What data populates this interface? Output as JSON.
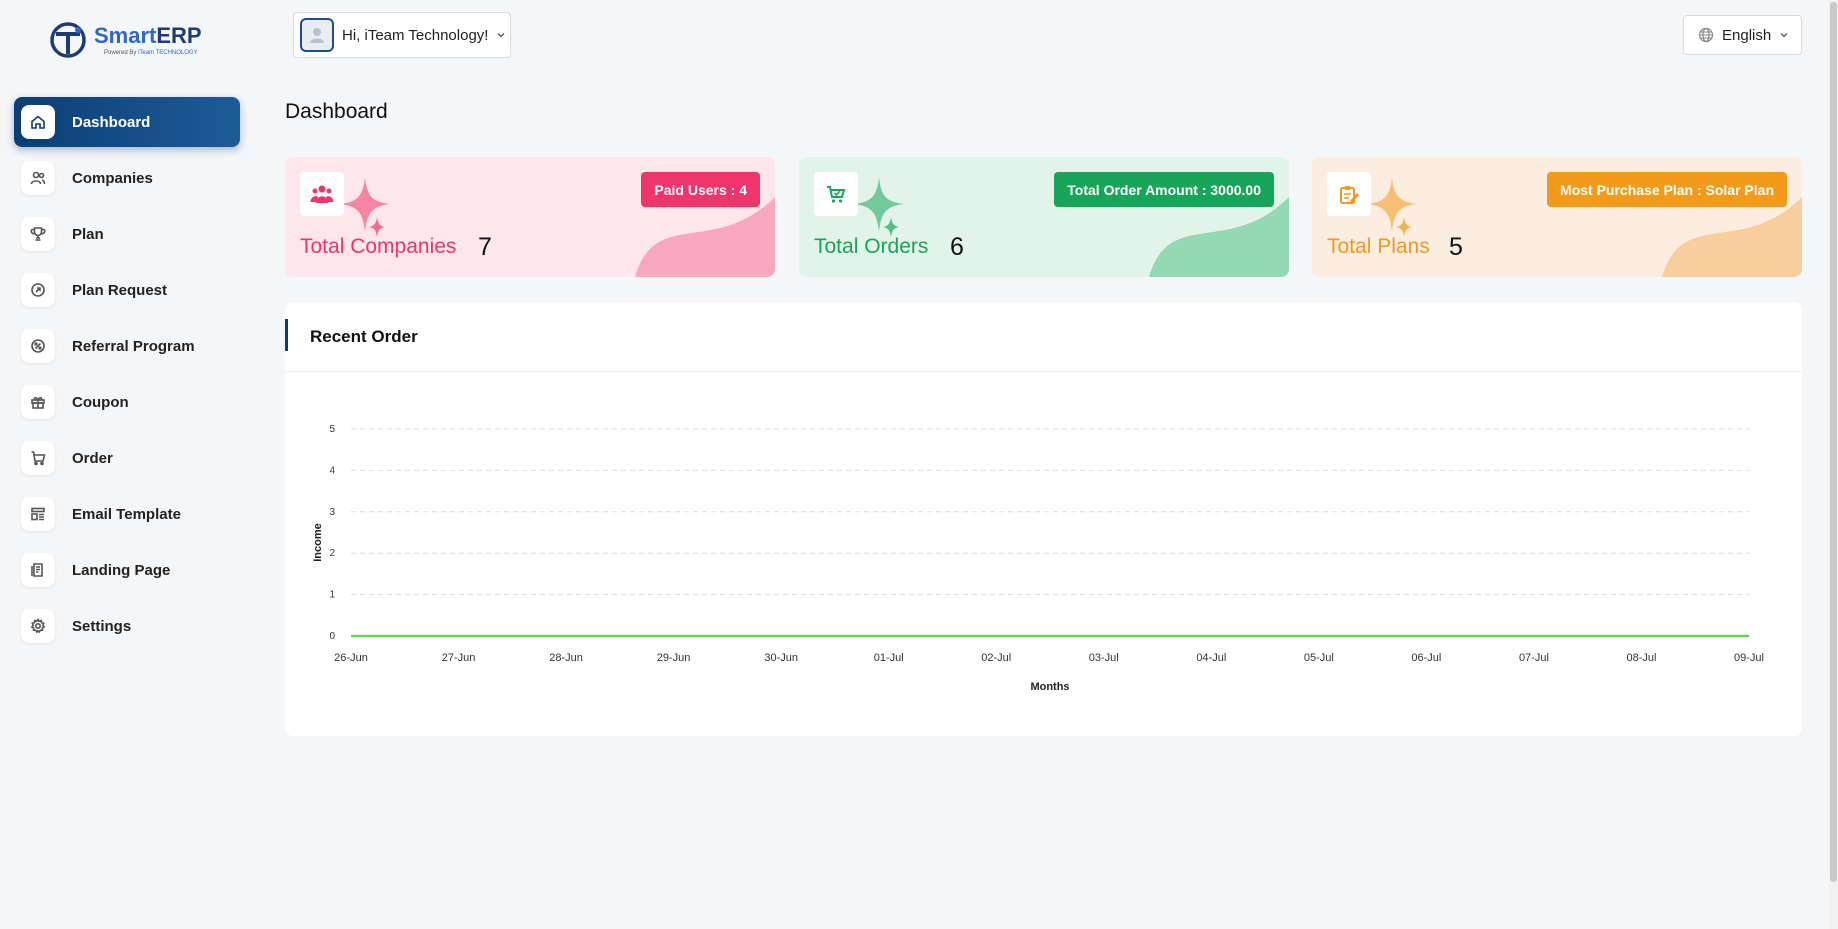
{
  "app": {
    "brand_name_part1": "Smart",
    "brand_name_part2": "ERP",
    "powered_by": "Powered By",
    "powered_brand": "iTeam TECHNOLOGY"
  },
  "sidebar": {
    "items": [
      {
        "label": "Dashboard",
        "icon": "home-icon",
        "active": true
      },
      {
        "label": "Companies",
        "icon": "users-icon"
      },
      {
        "label": "Plan",
        "icon": "trophy-icon"
      },
      {
        "label": "Plan Request",
        "icon": "arrow-circle-icon"
      },
      {
        "label": "Referral Program",
        "icon": "discount-icon"
      },
      {
        "label": "Coupon",
        "icon": "gift-icon"
      },
      {
        "label": "Order",
        "icon": "cart-icon"
      },
      {
        "label": " Email Template",
        "icon": "template-icon"
      },
      {
        "label": "Landing Page",
        "icon": "page-icon"
      },
      {
        "label": "Settings",
        "icon": "gear-icon"
      }
    ]
  },
  "header": {
    "user_greeting": "Hi, iTeam Technology!",
    "language": "English"
  },
  "page": {
    "title": "Dashboard"
  },
  "cards": [
    {
      "label": "Total Companies",
      "value": "7",
      "badge": "Paid Users : 4",
      "color": "#f0356a",
      "bg": "#fde7ec",
      "blob": "#f7a7be"
    },
    {
      "label": "Total Orders",
      "value": "6",
      "badge": "Total Order Amount : 3000.00",
      "color": "#16a559",
      "bg": "#e2f3ea",
      "blob": "#93d9b4"
    },
    {
      "label": "Total Plans",
      "value": "5",
      "badge": "Most Purchase Plan : Solar Plan",
      "color": "#f39a1b",
      "bg": "#fbeee0",
      "blob": "#f7cf9d"
    }
  ],
  "recent_order": {
    "title": "Recent Order"
  },
  "chart_data": {
    "type": "line",
    "x": [
      "26-Jun",
      "27-Jun",
      "28-Jun",
      "29-Jun",
      "30-Jun",
      "01-Jul",
      "02-Jul",
      "03-Jul",
      "04-Jul",
      "05-Jul",
      "06-Jul",
      "07-Jul",
      "08-Jul",
      "09-Jul"
    ],
    "series": [
      {
        "values": [
          0,
          0,
          0,
          0,
          0,
          0,
          0,
          0,
          0,
          0,
          0,
          0,
          0,
          0
        ],
        "color": "#6ccf5a"
      }
    ],
    "xlabel": "Months",
    "ylabel": "Income",
    "ylim": [
      0,
      5
    ],
    "yticks": [
      0,
      1,
      2,
      3,
      4,
      5
    ],
    "grid": true
  }
}
